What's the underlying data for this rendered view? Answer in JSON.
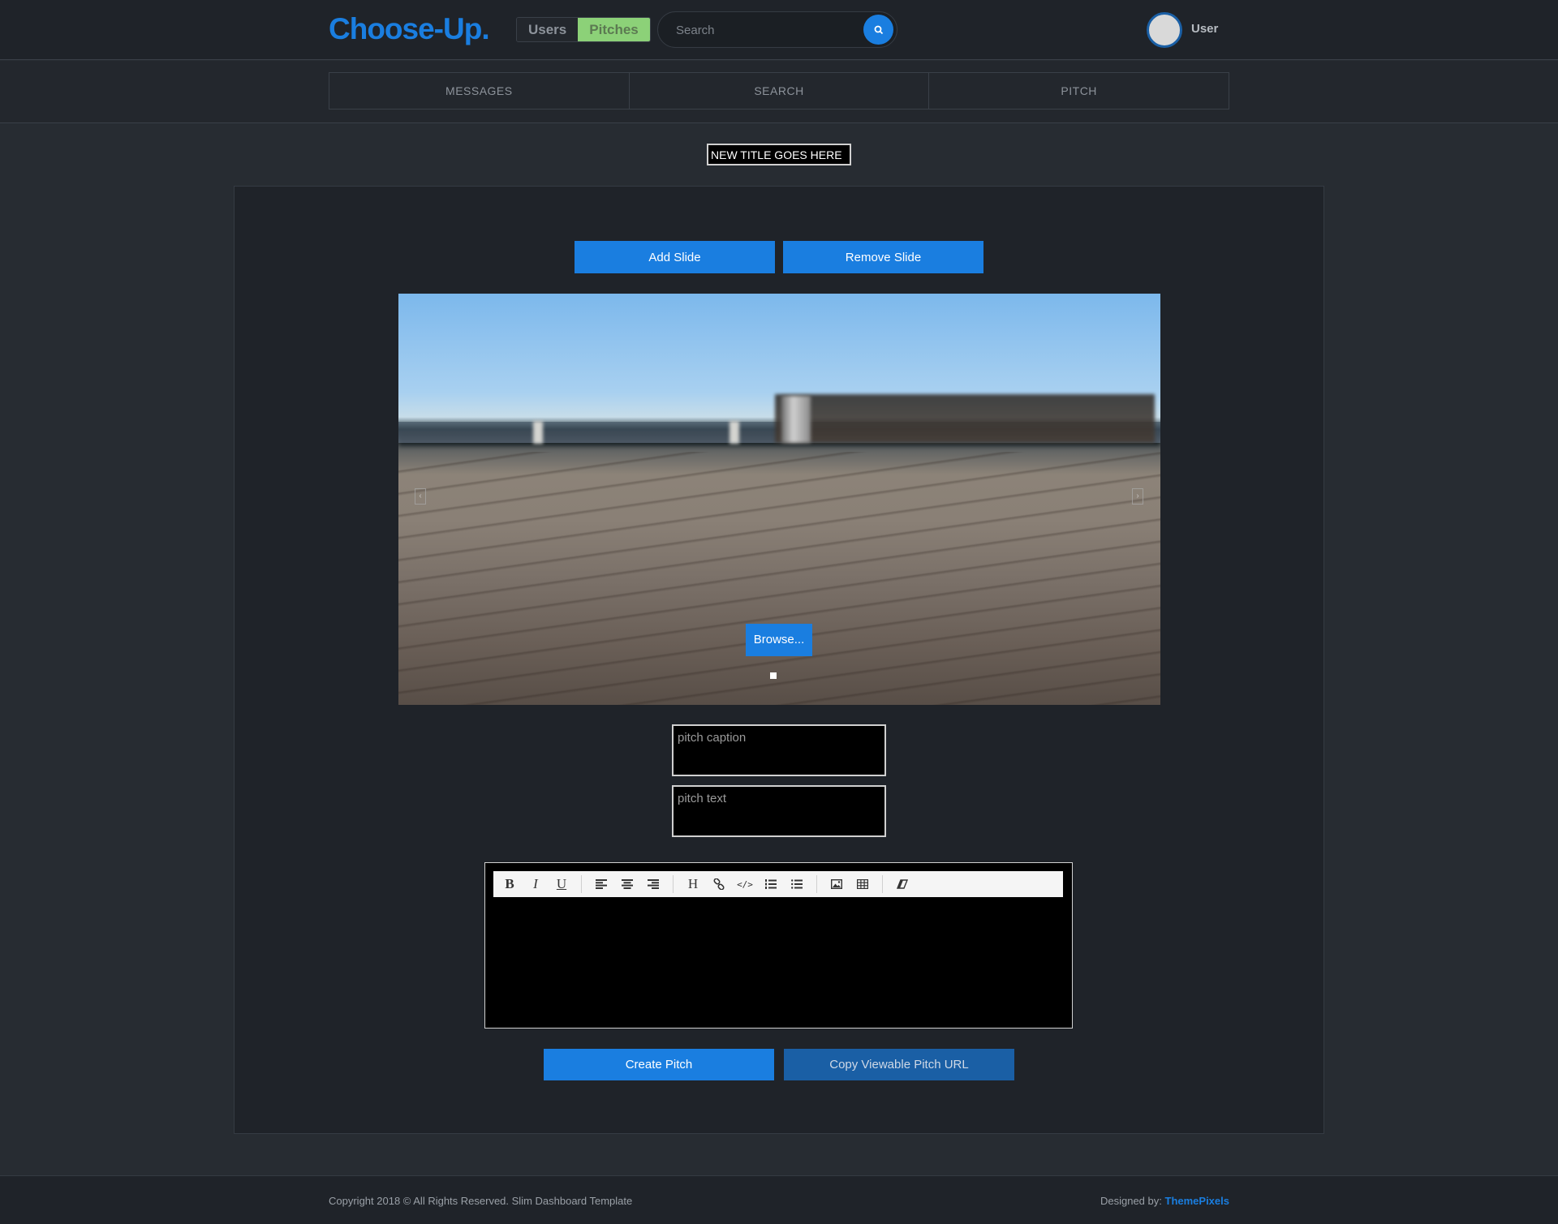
{
  "header": {
    "logo": "Choose-Up.",
    "tabs": [
      {
        "label": "Users",
        "active": false
      },
      {
        "label": "Pitches",
        "active": true
      }
    ],
    "search": {
      "placeholder": "Search",
      "icon": "search-icon"
    },
    "user": {
      "name": "User"
    }
  },
  "nav": {
    "tabs": [
      {
        "label": "MESSAGES"
      },
      {
        "label": "SEARCH"
      },
      {
        "label": "PITCH"
      }
    ]
  },
  "pitch": {
    "title_value": "NEW TITLE GOES HERE",
    "add_slide_label": "Add Slide",
    "remove_slide_label": "Remove Slide",
    "browse_label": "Browse...",
    "caption_placeholder": "pitch caption",
    "text_placeholder": "pitch text",
    "create_label": "Create Pitch",
    "copy_url_label": "Copy Viewable Pitch URL"
  },
  "editor": {
    "toolbar": [
      {
        "name": "bold-icon",
        "glyph": "B"
      },
      {
        "name": "italic-icon",
        "glyph": "I"
      },
      {
        "name": "underline-icon",
        "glyph": "U"
      },
      {
        "name": "align-left-icon"
      },
      {
        "name": "align-center-icon"
      },
      {
        "name": "align-right-icon"
      },
      {
        "name": "heading-icon",
        "glyph": "H"
      },
      {
        "name": "link-icon"
      },
      {
        "name": "code-icon",
        "glyph": "</>"
      },
      {
        "name": "ordered-list-icon"
      },
      {
        "name": "unordered-list-icon"
      },
      {
        "name": "image-icon"
      },
      {
        "name": "table-icon"
      },
      {
        "name": "eraser-icon"
      }
    ]
  },
  "footer": {
    "copyright": "Copyright 2018 © All Rights Reserved. Slim Dashboard Template",
    "designed_prefix": "Designed by:",
    "designed_link": "ThemePixels"
  },
  "colors": {
    "accent": "#1a7ee0",
    "active_tab": "#8cd178",
    "background": "#272c32"
  }
}
